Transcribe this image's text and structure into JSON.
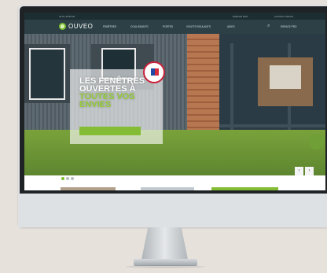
{
  "topbar": {
    "phone": "02 51 49 89 08",
    "link1": "ESPACE PRO",
    "link2": "CONTACT DEVIS"
  },
  "brand": {
    "name": "OUVEO",
    "logo_color": "#7bbf2e"
  },
  "nav": {
    "items": [
      "FENÊTRES",
      "COULISSANTS",
      "PORTES",
      "VOLETS ROULANTS",
      "AIDES"
    ],
    "search_icon": "search-icon",
    "account_label": "ESPACE PRO"
  },
  "hero": {
    "title_line1": "LES FENÊTRES",
    "title_line2": "OUVERTES À",
    "title_line3": "TOUTES VOS ENVIES",
    "body": "",
    "cta_label": "",
    "accent_color": "#84bd35",
    "slider_prev": "‹",
    "slider_next": "›"
  },
  "slider": {
    "dot_count": 3,
    "active_dot": 1
  }
}
